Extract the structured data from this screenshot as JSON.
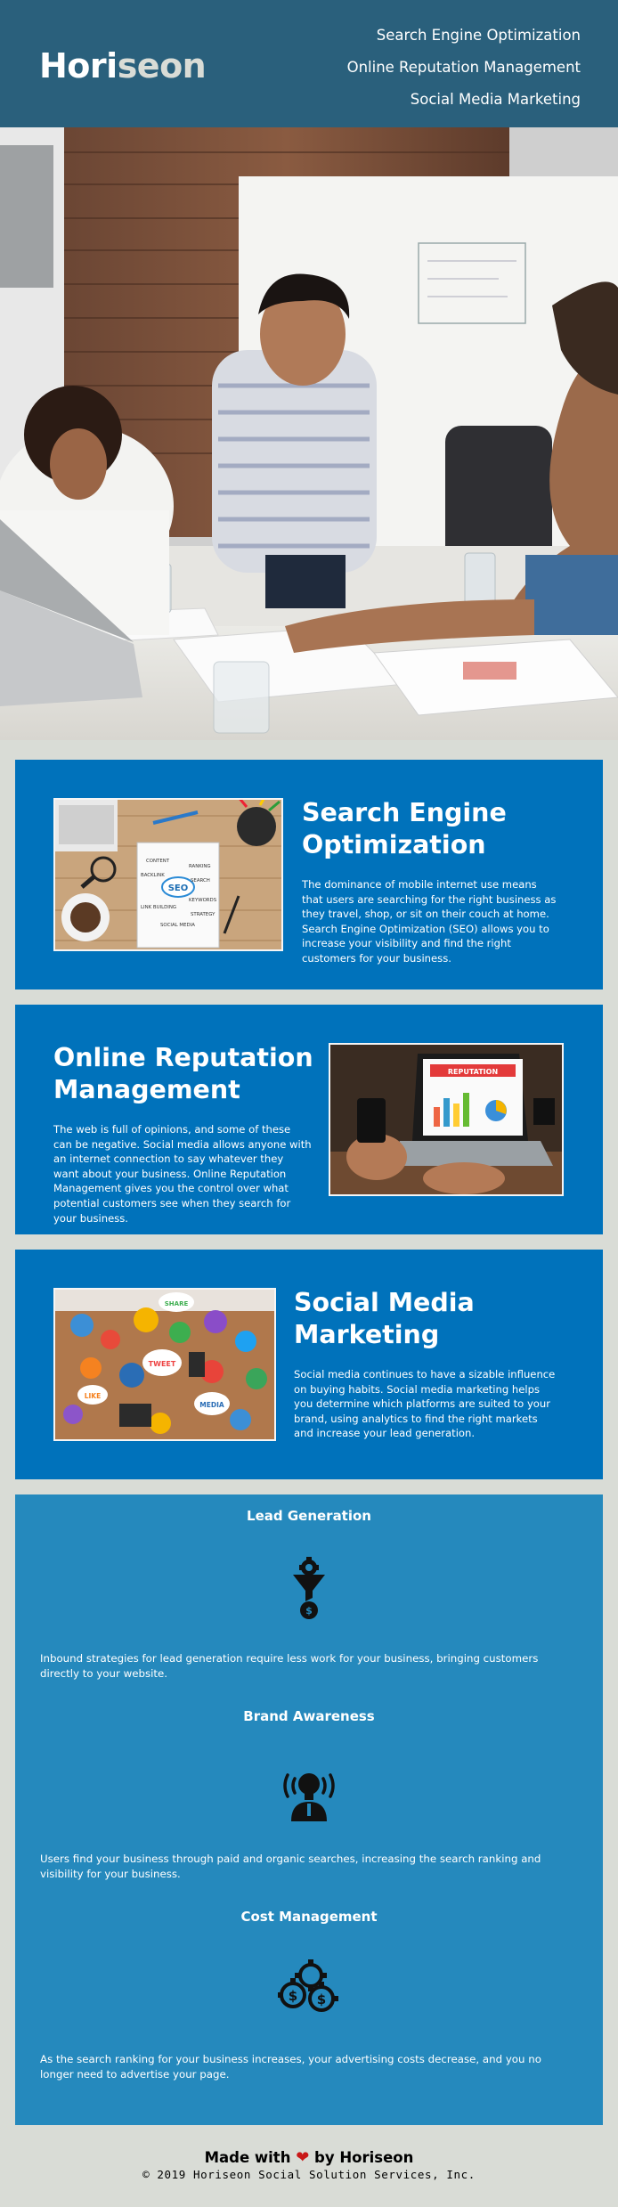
{
  "header": {
    "logo_main": "Hori",
    "logo_accent": "seon",
    "nav": [
      "Search Engine Optimization",
      "Online Reputation Management",
      "Social Media Marketing"
    ]
  },
  "cards": [
    {
      "title": "Search Engine Optimization",
      "body": "The dominance of mobile internet use means that users are searching for the right business as they travel, shop, or sit on their couch at home. Search Engine Optimization (SEO) allows you to increase your visibility and find the right customers for your business."
    },
    {
      "title": "Online Reputation Management",
      "body": "The web is full of opinions, and some of these can be negative. Social media allows anyone with an internet connection to say whatever they want about your business. Online Reputation Management gives you the control over what potential customers see when they search for your business."
    },
    {
      "title": "Social Media Marketing",
      "body": "Social media continues to have a sizable influence on buying habits. Social media marketing helps you determine which platforms are suited to your brand, using analytics to find the right markets and increase your lead generation."
    }
  ],
  "seo_image": {
    "seo_label": "SEO",
    "words": [
      "CONTENT",
      "RANKING",
      "BACKLINK",
      "SEARCH",
      "KEYWORDS",
      "LINK BUILDING",
      "STRATEGY",
      "SOCIAL MEDIA"
    ]
  },
  "reputation_image": {
    "banner": "REPUTATION"
  },
  "social_image": {
    "bubble_1": "TWEET",
    "bubble_2": "MEDIA",
    "bubble_3": "LIKE",
    "bubble_4": "SHARE"
  },
  "benefits": [
    {
      "title": "Lead Generation",
      "icon": "funnel-gear-icon",
      "body": "Inbound strategies for lead generation require less work for your business, bringing customers directly to your website."
    },
    {
      "title": "Brand Awareness",
      "icon": "lightbulb-head-icon",
      "body": "Users find your business through paid and organic searches, increasing the search ranking and visibility for your business."
    },
    {
      "title": "Cost Management",
      "icon": "gears-money-icon",
      "body": "As the search ranking for your business increases, your advertising costs decrease, and you no longer need to advertise your page."
    }
  ],
  "footer": {
    "made_with": "Made with",
    "by": "by Horiseon",
    "heart_icon": "heart-icon",
    "copyright": "© 2019 Horiseon Social Solution Services, Inc."
  },
  "colors": {
    "header_bg": "#2a607c",
    "page_bg": "#d9dcd6",
    "card_bg": "#0072bb",
    "benefits_bg": "#2589bd",
    "heart": "#c91818"
  }
}
